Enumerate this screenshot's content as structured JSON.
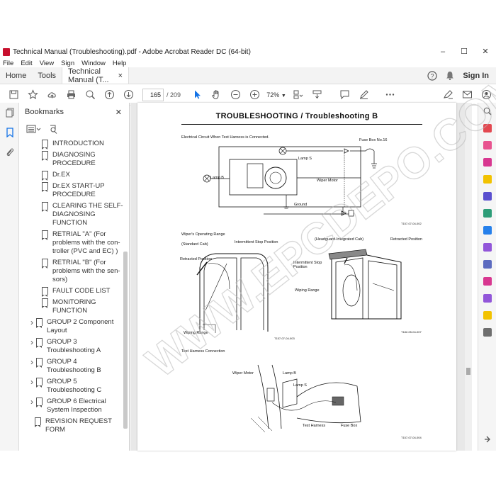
{
  "window": {
    "title": "Technical Manual (Troubleshooting).pdf - Adobe Acrobat Reader DC (64-bit)",
    "minimize": "–",
    "maximize": "☐",
    "close": "✕"
  },
  "menu": [
    "File",
    "Edit",
    "View",
    "Sign",
    "Window",
    "Help"
  ],
  "tabs": {
    "home": "Home",
    "tools": "Tools",
    "doc": "Technical Manual (T...",
    "doc_close": "×",
    "signin": "Sign In"
  },
  "toolbar": {
    "page_current": "165",
    "page_total": "/ 209",
    "zoom": "72%"
  },
  "bookmarks": {
    "title": "Bookmarks",
    "close": "✕",
    "items": [
      {
        "label": "INTRODUCTION",
        "level": 2,
        "expandable": false
      },
      {
        "label": "DIAGNOSING PROCEDURE",
        "level": 2,
        "expandable": false
      },
      {
        "label": "Dr.EX",
        "level": 2,
        "expandable": false
      },
      {
        "label": "Dr.EX START-UP PROCEDURE",
        "level": 2,
        "expandable": false
      },
      {
        "label": "CLEARING THE SELF-DIAGNOSING FUNCTION",
        "level": 2,
        "expandable": false
      },
      {
        "label": "RETRIAL \"A\" (For problems with the con-troller (PVC and EC) )",
        "level": 2,
        "expandable": false
      },
      {
        "label": "RETRIAL \"B\" (For problems with the sen-sors)",
        "level": 2,
        "expandable": false
      },
      {
        "label": "FAULT CODE LIST",
        "level": 2,
        "expandable": false
      },
      {
        "label": "MONITORING FUNCTION",
        "level": 2,
        "expandable": false
      },
      {
        "label": "GROUP 2 Component Layout",
        "level": 1,
        "expandable": true
      },
      {
        "label": "GROUP 3 Troubleshooting A",
        "level": 1,
        "expandable": true
      },
      {
        "label": "GROUP 4 Troubleshooting B",
        "level": 1,
        "expandable": true
      },
      {
        "label": "GROUP 5 Troubleshooting C",
        "level": 1,
        "expandable": true
      },
      {
        "label": "GROUP 6 Electrical System Inspection",
        "level": 1,
        "expandable": true
      },
      {
        "label": "REVISION REQUEST FORM",
        "level": 0,
        "expandable": false
      }
    ]
  },
  "page": {
    "header": "TROUBLESHOOTING / Troubleshooting B",
    "section1": "Electrical Circuit When Test Harness is Connected.",
    "fuse_box_no": "Fuse Box No.16",
    "lamp_s": "Lamp S",
    "lamp_b": "Lamp B",
    "wiper_motor": "Wiper Motor",
    "ground": "Ground",
    "code1": "T157-07-04-002",
    "section2": "Wiper's Operating Range",
    "standard_cab": "(Standard Cab)",
    "headguard_cab": "(Headguard-Integrated Cab)",
    "intermittent_stop": "Intermittent Stop Position",
    "intermittent_stop2a": "Intermittent Stop",
    "intermittent_stop2b": "Position",
    "retracted": "Retracted Position",
    "retracted2": "Retracted Position",
    "wiping_range": "Wiping Range",
    "wiping_range2": "Wiping Range",
    "code2": "T157-07-04-003",
    "code3": "T182-05-04-007",
    "section3": "Test Harness Connection",
    "wiper_motor2": "Wiper Motor",
    "lamp_b2": "Lamp B",
    "lamp_s2": "Lamp S",
    "test_harness": "Test Harness",
    "fuse_box": "Fuse Box",
    "code4": "T157-07-04-004"
  },
  "watermark": "WWW.EPCDEPO.COM",
  "colors": {
    "accent": "#1473e6",
    "pdf_red": "#c8102e"
  }
}
